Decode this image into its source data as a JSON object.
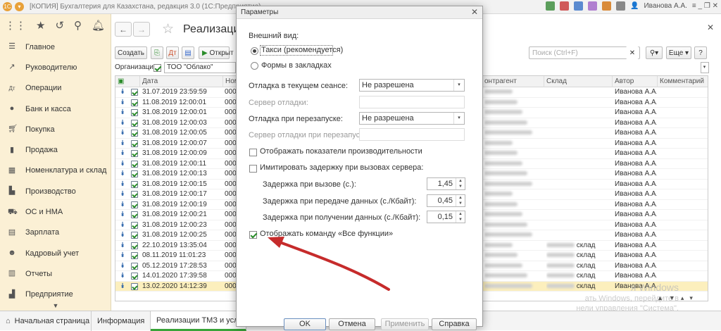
{
  "window": {
    "title": "[КОПИЯ] Бухгалтерия для Казахстана, редакция 3.0  (1С:Предприятие)",
    "user": "Иванова А.А."
  },
  "sidebar": {
    "items": [
      {
        "label": "Главное",
        "icon": "menu-icon"
      },
      {
        "label": "Руководителю",
        "icon": "chart-line-icon"
      },
      {
        "label": "Операции",
        "icon": "dt-kt-icon"
      },
      {
        "label": "Банк и касса",
        "icon": "coin-icon"
      },
      {
        "label": "Покупка",
        "icon": "cart-icon"
      },
      {
        "label": "Продажа",
        "icon": "bag-icon"
      },
      {
        "label": "Номенклатура и склад",
        "icon": "boxes-icon"
      },
      {
        "label": "Производство",
        "icon": "factory-icon"
      },
      {
        "label": "ОС и НМА",
        "icon": "truck-icon"
      },
      {
        "label": "Зарплата",
        "icon": "wallet-icon"
      },
      {
        "label": "Кадровый учет",
        "icon": "person-icon"
      },
      {
        "label": "Отчеты",
        "icon": "report-icon"
      },
      {
        "label": "Предприятие",
        "icon": "building-icon"
      }
    ]
  },
  "document": {
    "title": "Реализаци",
    "create_label": "Создать",
    "open_label": "Открыт",
    "search_placeholder": "Поиск (Ctrl+F)",
    "more_label": "Еще",
    "help_label": "?",
    "org_label": "Организация:",
    "org_value": "ТОО \"Облако\""
  },
  "table": {
    "columns": [
      "Дата",
      "Номе",
      "онтрагент",
      "Склад",
      "Автор",
      "Комментарий"
    ],
    "rows": [
      {
        "date": "31.07.2019 23:59:59",
        "num": "0000",
        "author": "Иванова А.А.",
        "sklad": ""
      },
      {
        "date": "11.08.2019 12:00:01",
        "num": "0000",
        "author": "Иванова А.А.",
        "sklad": ""
      },
      {
        "date": "31.08.2019 12:00:01",
        "num": "0000",
        "author": "Иванова А.А.",
        "sklad": ""
      },
      {
        "date": "31.08.2019 12:00:03",
        "num": "0000",
        "author": "Иванова А.А.",
        "sklad": ""
      },
      {
        "date": "31.08.2019 12:00:05",
        "num": "0000",
        "author": "Иванова А.А.",
        "sklad": ""
      },
      {
        "date": "31.08.2019 12:00:07",
        "num": "0000",
        "author": "Иванова А.А.",
        "sklad": ""
      },
      {
        "date": "31.08.2019 12:00:09",
        "num": "0000",
        "author": "Иванова А.А.",
        "sklad": ""
      },
      {
        "date": "31.08.2019 12:00:11",
        "num": "0000",
        "author": "Иванова А.А.",
        "sklad": ""
      },
      {
        "date": "31.08.2019 12:00:13",
        "num": "0000",
        "author": "Иванова А.А.",
        "sklad": ""
      },
      {
        "date": "31.08.2019 12:00:15",
        "num": "0000",
        "author": "Иванова А.А.",
        "sklad": ""
      },
      {
        "date": "31.08.2019 12:00:17",
        "num": "0000",
        "author": "Иванова А.А.",
        "sklad": ""
      },
      {
        "date": "31.08.2019 12:00:19",
        "num": "0000",
        "author": "Иванова А.А.",
        "sklad": ""
      },
      {
        "date": "31.08.2019 12:00:21",
        "num": "0000",
        "author": "Иванова А.А.",
        "sklad": ""
      },
      {
        "date": "31.08.2019 12:00:23",
        "num": "0000",
        "author": "Иванова А.А.",
        "sklad": ""
      },
      {
        "date": "31.08.2019 12:00:25",
        "num": "0000",
        "author": "Иванова А.А.",
        "sklad": ""
      },
      {
        "date": "22.10.2019 13:35:04",
        "num": "0000",
        "author": "Иванова А.А.",
        "sklad": "склад"
      },
      {
        "date": "08.11.2019 11:01:23",
        "num": "0000",
        "author": "Иванова А.А.",
        "sklad": "склад"
      },
      {
        "date": "05.12.2019 17:28:53",
        "num": "0000",
        "author": "Иванова А.А.",
        "sklad": "склад"
      },
      {
        "date": "14.01.2020 17:39:58",
        "num": "0000",
        "author": "Иванова А.А.",
        "sklad": "склад"
      },
      {
        "date": "13.02.2020 14:12:39",
        "num": "0000",
        "author": "Иванова А.А.",
        "sklad": "склад"
      }
    ]
  },
  "bottom_tabs": [
    "Начальная страница",
    "Информация",
    "Реализации ТМЗ и услуг"
  ],
  "watermark": {
    "line1": "я Windows",
    "line2": "ать Windows, перейдите в",
    "line3": "нели управления \"Система\"."
  },
  "dialog": {
    "title": "Параметры",
    "appearance_label": "Внешний вид:",
    "radio_taxi": "Такси (рекомендуется)",
    "radio_tabs": "Формы в закладках",
    "debug_session_label": "Отладка в текущем сеансе:",
    "debug_session_value": "Не разрешена",
    "debug_server_label": "Сервер отладки:",
    "debug_restart_label": "Отладка при перезапуске:",
    "debug_restart_value": "Не разрешена",
    "debug_restart_server_label": "Сервер отладки при перезапуске:",
    "perf_label": "Отображать показатели производительности",
    "delay_label": "Имитировать задержку при вызовах сервера:",
    "call_delay_label": "Задержка при вызове (с.):",
    "call_delay_value": "1,45",
    "send_delay_label": "Задержка при передаче данных (с./Кбайт):",
    "send_delay_value": "0,45",
    "recv_delay_label": "Задержка при получении данных (с./Кбайт):",
    "recv_delay_value": "0,15",
    "all_functions_label": "Отображать команду «Все функции»",
    "ok_label": "OK",
    "cancel_label": "Отмена",
    "apply_label": "Применить",
    "help_label": "Справка"
  }
}
